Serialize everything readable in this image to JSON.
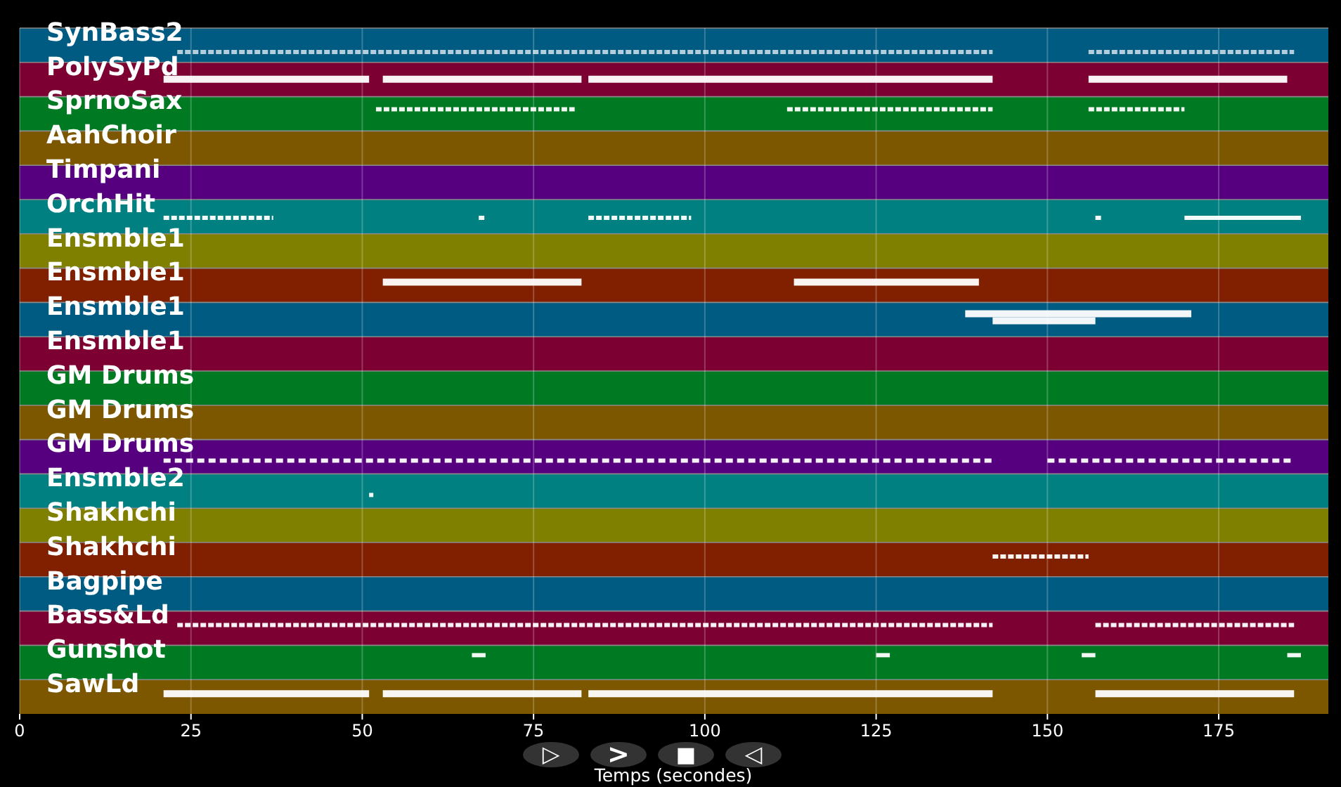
{
  "tracks": [
    {
      "name": "SynBass2",
      "color": "#005b82"
    },
    {
      "name": "PolySyPd",
      "color": "#7d0032"
    },
    {
      "name": "SprnoSax",
      "color": "#007a22"
    },
    {
      "name": "AahChoir",
      "color": "#7d5700"
    },
    {
      "name": "Timpani",
      "color": "#560080"
    },
    {
      "name": "OrchHit",
      "color": "#008080"
    },
    {
      "name": "Ensmble1",
      "color": "#808000"
    },
    {
      "name": "Ensmble1",
      "color": "#802000"
    },
    {
      "name": "Ensmble1",
      "color": "#005b82"
    },
    {
      "name": "Ensmble1",
      "color": "#7d0032"
    },
    {
      "name": "GM Drums",
      "color": "#007a22"
    },
    {
      "name": "GM Drums",
      "color": "#7d5700"
    },
    {
      "name": "GM Drums",
      "color": "#560080"
    },
    {
      "name": "Ensmble2",
      "color": "#008080"
    },
    {
      "name": "Shakhchi",
      "color": "#808000"
    },
    {
      "name": "Shakhchi",
      "color": "#802000"
    },
    {
      "name": "Bagpipe",
      "color": "#005b82"
    },
    {
      "name": "Bass&Ld",
      "color": "#7d0032"
    },
    {
      "name": "Gunshot",
      "color": "#007a22"
    },
    {
      "name": "SawLd",
      "color": "#7d5700"
    }
  ],
  "axis": {
    "label": "Temps (secondes)",
    "ticks": [
      "0",
      "25",
      "50",
      "75",
      "100",
      "125",
      "150",
      "175"
    ]
  },
  "controls": [
    {
      "label": "▷",
      "kind": "play"
    },
    {
      "label": ">",
      "kind": "forward"
    },
    {
      "label": "■",
      "kind": "stop"
    },
    {
      "label": "◁",
      "kind": "back"
    }
  ]
}
